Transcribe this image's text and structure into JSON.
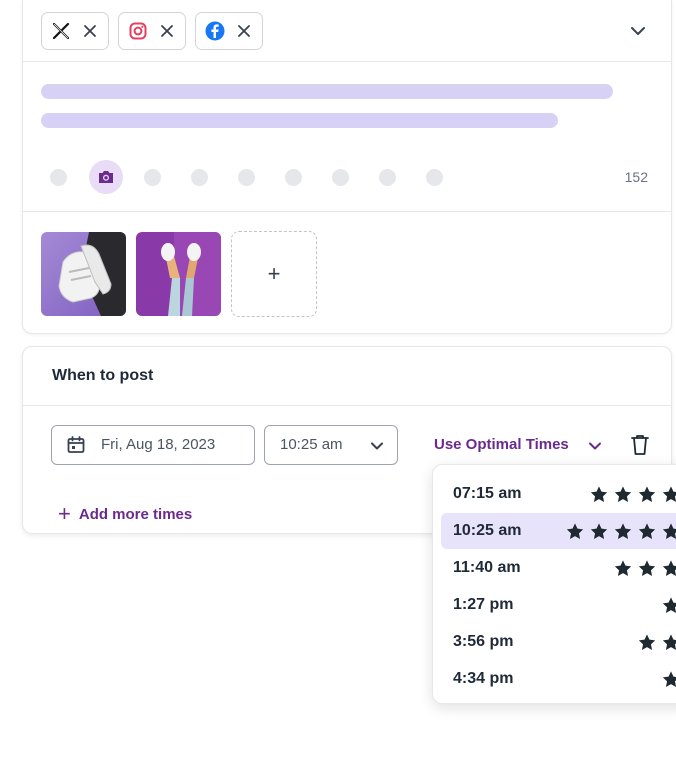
{
  "networks": [
    {
      "name": "x-twitter",
      "remove_label": "×"
    },
    {
      "name": "instagram",
      "remove_label": "×"
    },
    {
      "name": "facebook",
      "remove_label": "×"
    }
  ],
  "composer": {
    "char_count": "152",
    "add_media_label": "+"
  },
  "schedule": {
    "title": "When to post",
    "date_value": "Fri, Aug 18, 2023",
    "time_value": "10:25 am",
    "optimal_label": "Use Optimal Times",
    "add_more_label": "Add more times",
    "add_more_icon": "+"
  },
  "optimal_times": [
    {
      "time": "07:15 am",
      "stars": 4,
      "selected": false
    },
    {
      "time": "10:25 am",
      "stars": 5,
      "selected": true
    },
    {
      "time": "11:40 am",
      "stars": 3,
      "selected": false
    },
    {
      "time": "1:27 pm",
      "stars": 1,
      "selected": false
    },
    {
      "time": "3:56 pm",
      "stars": 2,
      "selected": false
    },
    {
      "time": "4:34 pm",
      "stars": 1,
      "selected": false
    }
  ],
  "colors": {
    "accent": "#6b2a8e",
    "selected_bg": "#e7e3fb",
    "skeleton": "#d8d1f6",
    "star": "#1f2a30"
  }
}
